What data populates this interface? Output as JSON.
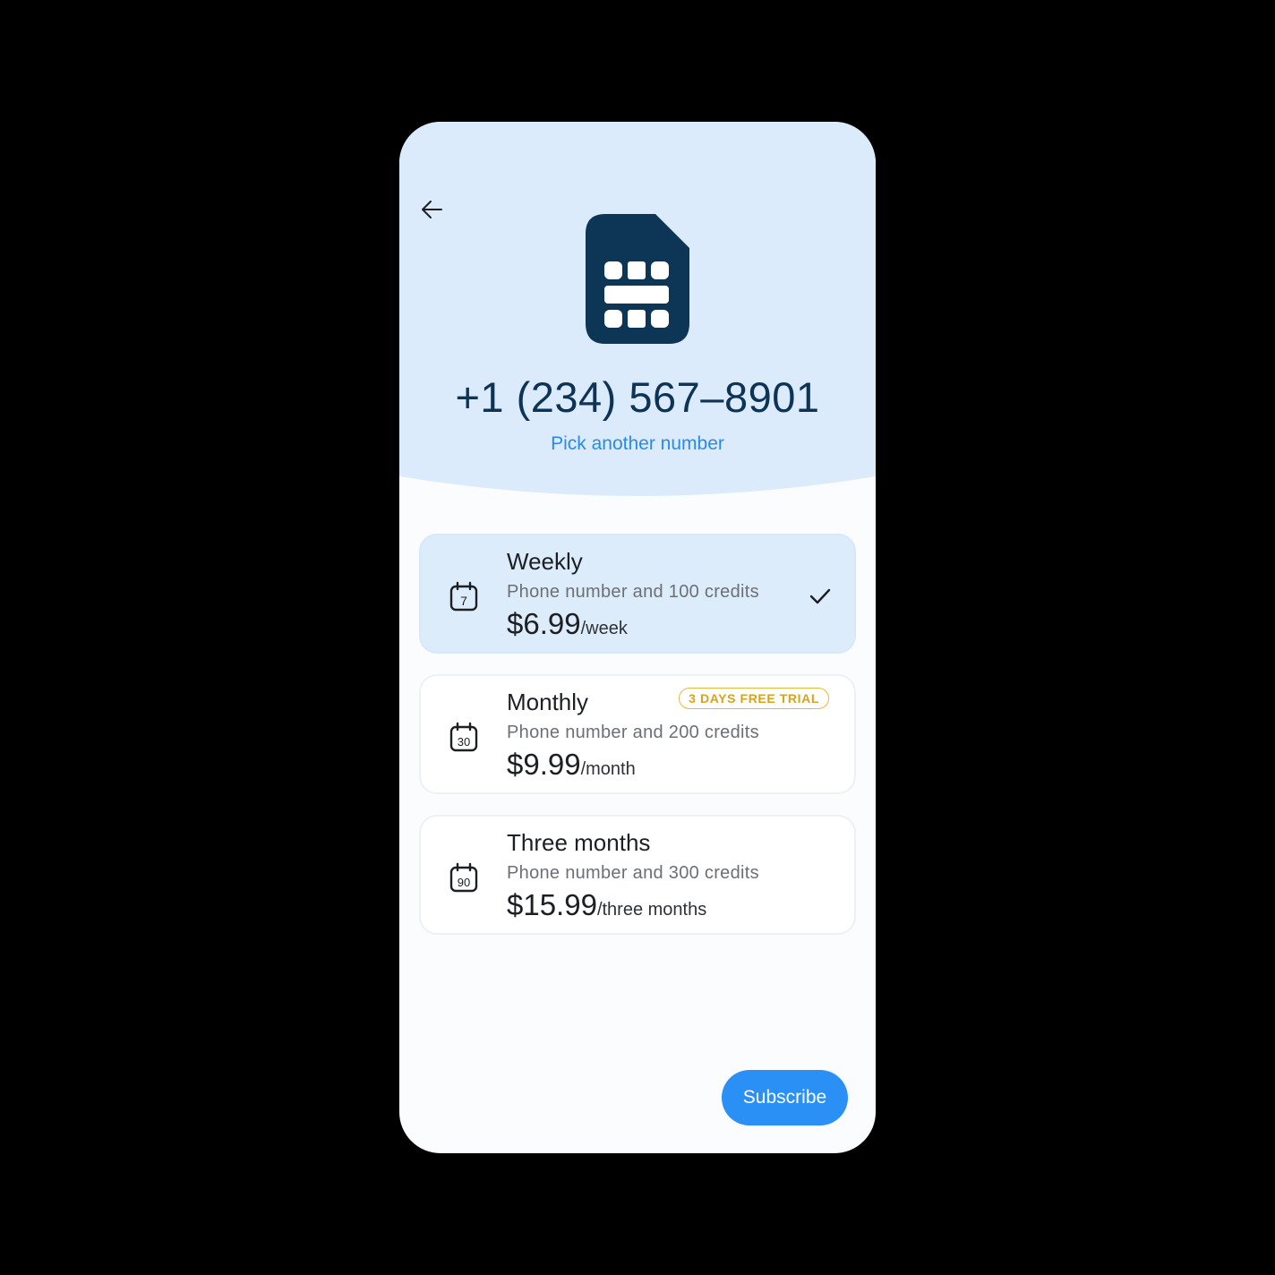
{
  "header": {
    "phone_number": "+1 (234) 567–8901",
    "pick_another_label": "Pick another number"
  },
  "plans": [
    {
      "title": "Weekly",
      "description": "Phone number and 100 credits",
      "price": "$6.99",
      "unit": "/week",
      "icon": "calendar-7-icon",
      "icon_number": "7",
      "selected": true
    },
    {
      "title": "Monthly",
      "description": "Phone number and 200 credits",
      "price": "$9.99",
      "unit": "/month",
      "icon": "calendar-30-icon",
      "icon_number": "30",
      "badge": "3 DAYS FREE TRIAL",
      "selected": false
    },
    {
      "title": "Three months",
      "description": "Phone number and 300 credits",
      "price": "$15.99",
      "unit": "/three months",
      "icon": "calendar-90-icon",
      "icon_number": "90",
      "selected": false
    }
  ],
  "subscribe_label": "Subscribe",
  "colors": {
    "header_bg": "#dcebfb",
    "sim_icon": "#0c3556",
    "accent_link": "#2a8be6",
    "button": "#2b90f5",
    "badge": "#e7b93a"
  }
}
